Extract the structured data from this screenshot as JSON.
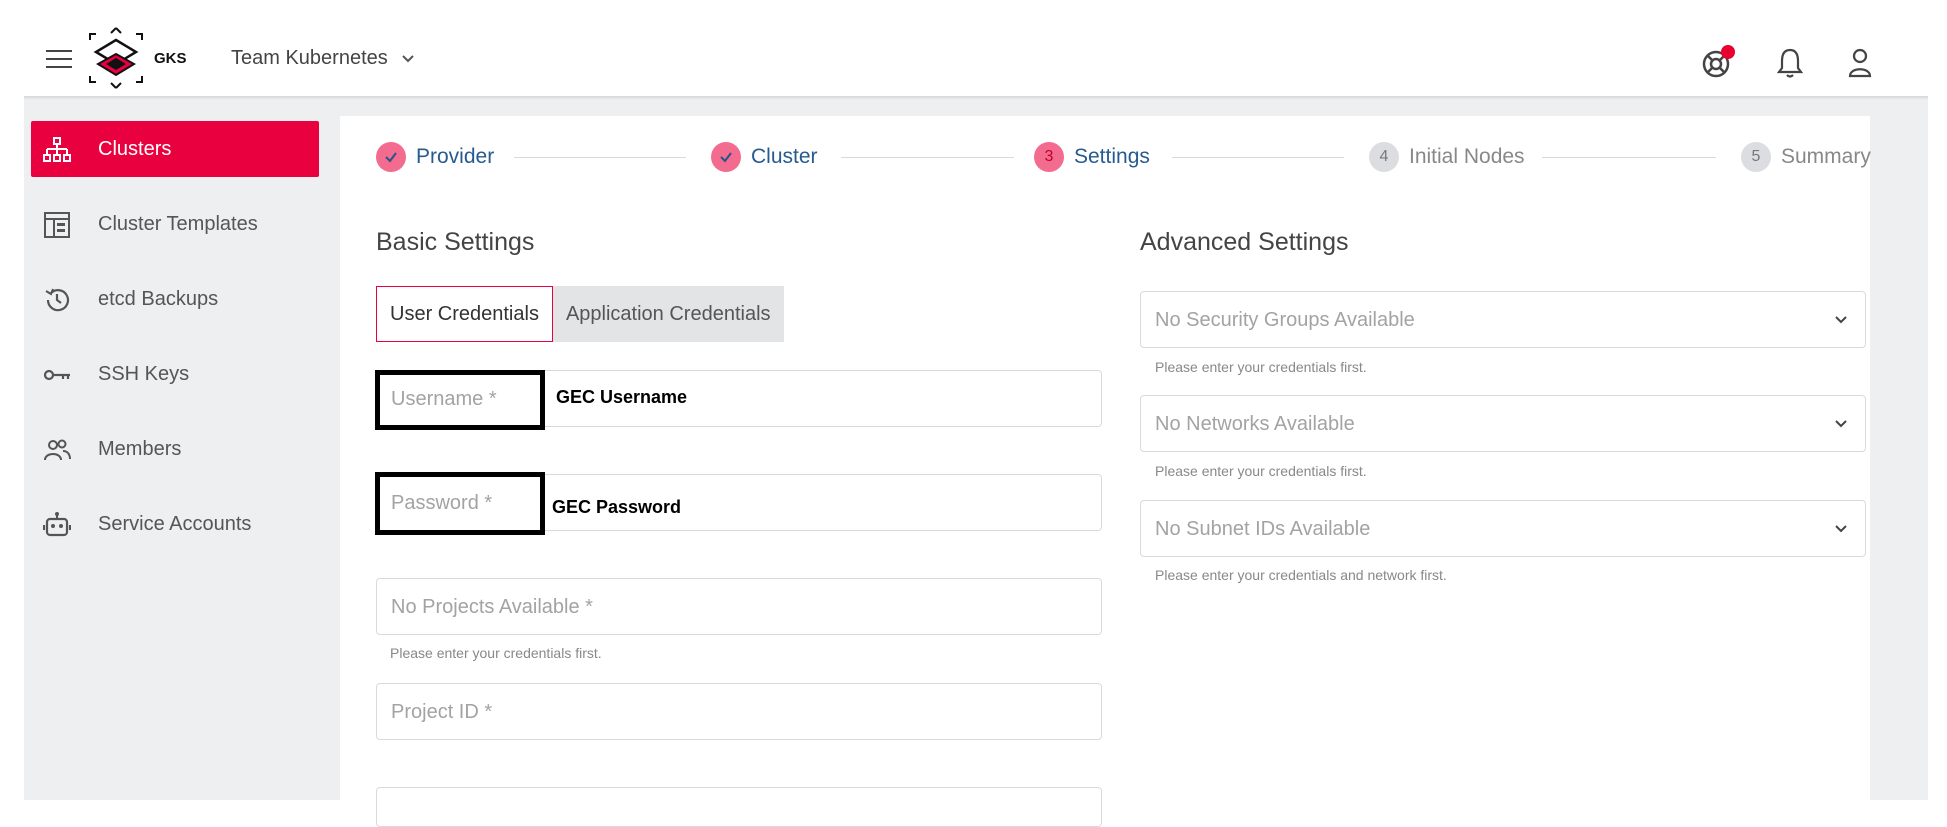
{
  "header": {
    "brand": "GKS",
    "team": "Team Kubernetes"
  },
  "sidebar": {
    "items": [
      {
        "label": "Clusters",
        "icon": "sitemap-icon",
        "active": true
      },
      {
        "label": "Cluster Templates",
        "icon": "template-icon",
        "active": false
      },
      {
        "label": "etcd Backups",
        "icon": "history-icon",
        "active": false
      },
      {
        "label": "SSH Keys",
        "icon": "key-icon",
        "active": false
      },
      {
        "label": "Members",
        "icon": "people-icon",
        "active": false
      },
      {
        "label": "Service Accounts",
        "icon": "robot-icon",
        "active": false
      }
    ]
  },
  "stepper": {
    "steps": [
      {
        "num": "",
        "label": "Provider",
        "state": "done"
      },
      {
        "num": "",
        "label": "Cluster",
        "state": "done"
      },
      {
        "num": "3",
        "label": "Settings",
        "state": "current"
      },
      {
        "num": "4",
        "label": "Initial Nodes",
        "state": "todo"
      },
      {
        "num": "5",
        "label": "Summary",
        "state": "todo"
      }
    ]
  },
  "basic": {
    "title": "Basic Settings",
    "tabs": [
      "User Credentials",
      "Application Credentials"
    ],
    "username_placeholder": "Username *",
    "password_placeholder": "Password *",
    "projects_placeholder": "No Projects Available *",
    "projects_hint": "Please enter your credentials first.",
    "project_id_placeholder": "Project ID *"
  },
  "advanced": {
    "title": "Advanced Settings",
    "security_groups": "No Security Groups Available",
    "security_groups_hint": "Please enter your credentials first.",
    "networks": "No Networks Available",
    "networks_hint": "Please enter your credentials first.",
    "subnets": "No Subnet IDs Available",
    "subnets_hint": "Please enter your credentials and network first."
  },
  "annotations": {
    "username": "GEC Username",
    "password": "GEC Password"
  },
  "colors": {
    "accent": "#e8003f",
    "step_done": "#f36b8f",
    "step_label": "#275b8f"
  }
}
